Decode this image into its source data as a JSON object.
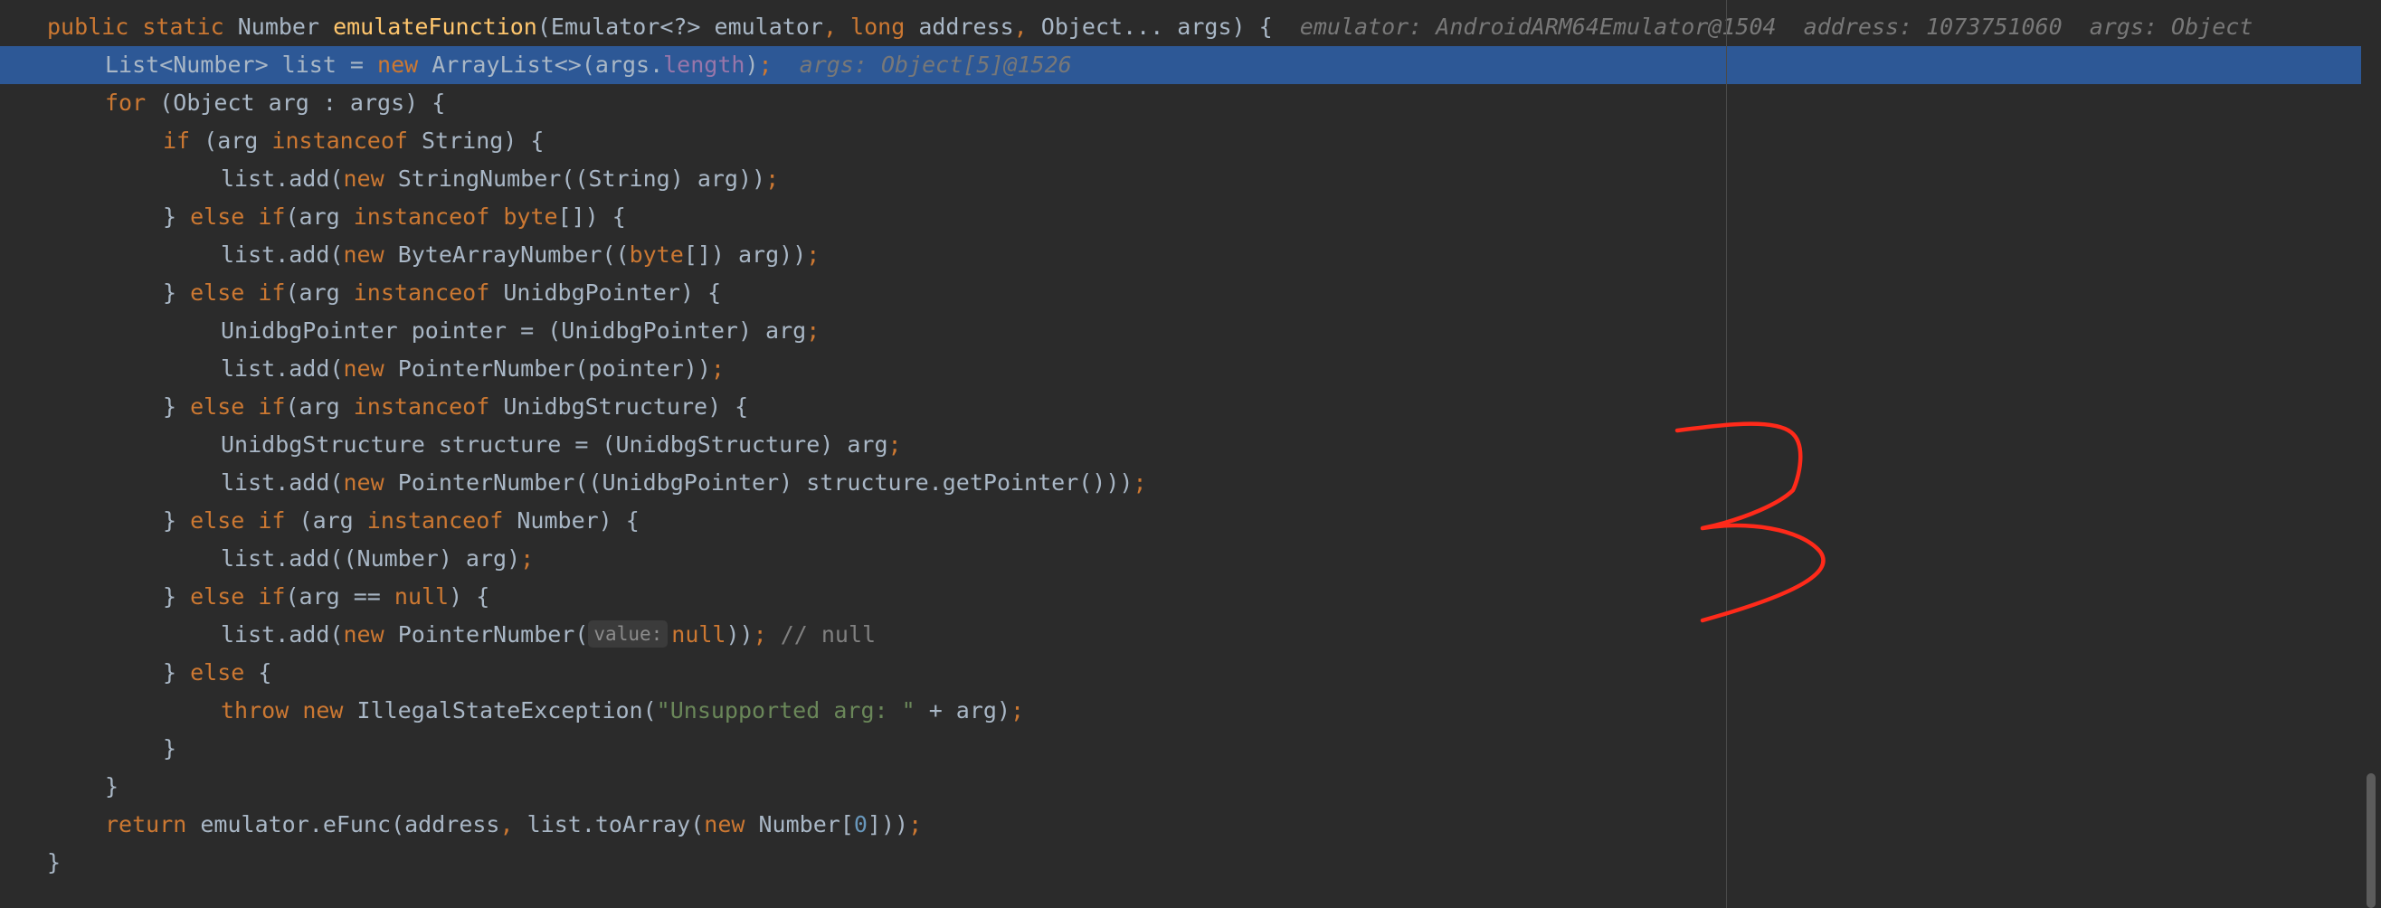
{
  "editor": {
    "lines": [
      {
        "indent": 0,
        "highlighted": false,
        "tokens": [
          {
            "t": "public ",
            "c": "kw"
          },
          {
            "t": "static ",
            "c": "kw"
          },
          {
            "t": "Number ",
            "c": ""
          },
          {
            "t": "emulateFunction",
            "c": "fn"
          },
          {
            "t": "(Emulator<?> emulator",
            "c": ""
          },
          {
            "t": ", ",
            "c": "kw"
          },
          {
            "t": "long ",
            "c": "kw"
          },
          {
            "t": "address",
            "c": ""
          },
          {
            "t": ", ",
            "c": "kw"
          },
          {
            "t": "Object... args) {  ",
            "c": ""
          },
          {
            "t": "emulator: AndroidARM64Emulator@1504  address: 1073751060  args: Object",
            "c": "hint"
          }
        ]
      },
      {
        "indent": 1,
        "highlighted": true,
        "tokens": [
          {
            "t": "List<Number> list = ",
            "c": ""
          },
          {
            "t": "new ",
            "c": "kw"
          },
          {
            "t": "ArrayList<>(args.",
            "c": ""
          },
          {
            "t": "length",
            "c": "fld"
          },
          {
            "t": ")",
            "c": ""
          },
          {
            "t": ";  ",
            "c": "kw"
          },
          {
            "t": "args: Object[5]@1526",
            "c": "hint"
          }
        ]
      },
      {
        "indent": 1,
        "highlighted": false,
        "tokens": [
          {
            "t": "for ",
            "c": "kw"
          },
          {
            "t": "(Object arg : args) {",
            "c": ""
          }
        ]
      },
      {
        "indent": 2,
        "highlighted": false,
        "tokens": [
          {
            "t": "if ",
            "c": "kw"
          },
          {
            "t": "(arg ",
            "c": ""
          },
          {
            "t": "instanceof ",
            "c": "kw"
          },
          {
            "t": "String) {",
            "c": ""
          }
        ]
      },
      {
        "indent": 3,
        "highlighted": false,
        "tokens": [
          {
            "t": "list.add(",
            "c": ""
          },
          {
            "t": "new ",
            "c": "kw"
          },
          {
            "t": "StringNumber((String) arg))",
            "c": ""
          },
          {
            "t": ";",
            "c": "kw"
          }
        ]
      },
      {
        "indent": 2,
        "highlighted": false,
        "tokens": [
          {
            "t": "} ",
            "c": ""
          },
          {
            "t": "else if",
            "c": "kw"
          },
          {
            "t": "(arg ",
            "c": ""
          },
          {
            "t": "instanceof ",
            "c": "kw"
          },
          {
            "t": "byte",
            "c": "kw"
          },
          {
            "t": "[]) {",
            "c": ""
          }
        ]
      },
      {
        "indent": 3,
        "highlighted": false,
        "tokens": [
          {
            "t": "list.add(",
            "c": ""
          },
          {
            "t": "new ",
            "c": "kw"
          },
          {
            "t": "ByteArrayNumber((",
            "c": ""
          },
          {
            "t": "byte",
            "c": "kw"
          },
          {
            "t": "[]) arg))",
            "c": ""
          },
          {
            "t": ";",
            "c": "kw"
          }
        ]
      },
      {
        "indent": 2,
        "highlighted": false,
        "tokens": [
          {
            "t": "} ",
            "c": ""
          },
          {
            "t": "else if",
            "c": "kw"
          },
          {
            "t": "(arg ",
            "c": ""
          },
          {
            "t": "instanceof ",
            "c": "kw"
          },
          {
            "t": "UnidbgPointer) {",
            "c": ""
          }
        ]
      },
      {
        "indent": 3,
        "highlighted": false,
        "tokens": [
          {
            "t": "UnidbgPointer pointer = (UnidbgPointer) arg",
            "c": ""
          },
          {
            "t": ";",
            "c": "kw"
          }
        ]
      },
      {
        "indent": 3,
        "highlighted": false,
        "tokens": [
          {
            "t": "list.add(",
            "c": ""
          },
          {
            "t": "new ",
            "c": "kw"
          },
          {
            "t": "PointerNumber(pointer))",
            "c": ""
          },
          {
            "t": ";",
            "c": "kw"
          }
        ]
      },
      {
        "indent": 2,
        "highlighted": false,
        "tokens": [
          {
            "t": "} ",
            "c": ""
          },
          {
            "t": "else if",
            "c": "kw"
          },
          {
            "t": "(arg ",
            "c": ""
          },
          {
            "t": "instanceof ",
            "c": "kw"
          },
          {
            "t": "UnidbgStructure) {",
            "c": ""
          }
        ]
      },
      {
        "indent": 3,
        "highlighted": false,
        "tokens": [
          {
            "t": "UnidbgStructure structure = (UnidbgStructure) arg",
            "c": ""
          },
          {
            "t": ";",
            "c": "kw"
          }
        ]
      },
      {
        "indent": 3,
        "highlighted": false,
        "tokens": [
          {
            "t": "list.add(",
            "c": ""
          },
          {
            "t": "new ",
            "c": "kw"
          },
          {
            "t": "PointerNumber((UnidbgPointer) structure.getPointer()))",
            "c": ""
          },
          {
            "t": ";",
            "c": "kw"
          }
        ]
      },
      {
        "indent": 2,
        "highlighted": false,
        "tokens": [
          {
            "t": "} ",
            "c": ""
          },
          {
            "t": "else if ",
            "c": "kw"
          },
          {
            "t": "(arg ",
            "c": ""
          },
          {
            "t": "instanceof ",
            "c": "kw"
          },
          {
            "t": "Number) {",
            "c": ""
          }
        ]
      },
      {
        "indent": 3,
        "highlighted": false,
        "tokens": [
          {
            "t": "list.add((Number) arg)",
            "c": ""
          },
          {
            "t": ";",
            "c": "kw"
          }
        ]
      },
      {
        "indent": 2,
        "highlighted": false,
        "tokens": [
          {
            "t": "} ",
            "c": ""
          },
          {
            "t": "else if",
            "c": "kw"
          },
          {
            "t": "(arg == ",
            "c": ""
          },
          {
            "t": "null",
            "c": "kw"
          },
          {
            "t": ") {",
            "c": ""
          }
        ]
      },
      {
        "indent": 3,
        "highlighted": false,
        "tokens": [
          {
            "t": "list.add(",
            "c": ""
          },
          {
            "t": "new ",
            "c": "kw"
          },
          {
            "t": "PointerNumber(",
            "c": ""
          },
          {
            "t": "value:",
            "c": "inlay"
          },
          {
            "t": "null",
            "c": "kw"
          },
          {
            "t": "))",
            "c": ""
          },
          {
            "t": "; ",
            "c": "kw"
          },
          {
            "t": "// null",
            "c": "cmt"
          }
        ]
      },
      {
        "indent": 2,
        "highlighted": false,
        "tokens": [
          {
            "t": "} ",
            "c": ""
          },
          {
            "t": "else ",
            "c": "kw"
          },
          {
            "t": "{",
            "c": ""
          }
        ]
      },
      {
        "indent": 3,
        "highlighted": false,
        "tokens": [
          {
            "t": "throw ",
            "c": "kw"
          },
          {
            "t": "new ",
            "c": "kw"
          },
          {
            "t": "IllegalStateException(",
            "c": ""
          },
          {
            "t": "\"Unsupported arg: \"",
            "c": "str"
          },
          {
            "t": " + arg)",
            "c": ""
          },
          {
            "t": ";",
            "c": "kw"
          }
        ]
      },
      {
        "indent": 2,
        "highlighted": false,
        "tokens": [
          {
            "t": "}",
            "c": ""
          }
        ]
      },
      {
        "indent": 1,
        "highlighted": false,
        "tokens": [
          {
            "t": "}",
            "c": ""
          }
        ]
      },
      {
        "indent": 1,
        "highlighted": false,
        "tokens": [
          {
            "t": "return ",
            "c": "kw"
          },
          {
            "t": "emulator.eFunc(address",
            "c": ""
          },
          {
            "t": ", ",
            "c": "kw"
          },
          {
            "t": "list.toArray(",
            "c": ""
          },
          {
            "t": "new ",
            "c": "kw"
          },
          {
            "t": "Number[",
            "c": ""
          },
          {
            "t": "0",
            "c": "num"
          },
          {
            "t": "]))",
            "c": ""
          },
          {
            "t": ";",
            "c": "kw"
          }
        ]
      },
      {
        "indent": 0,
        "highlighted": false,
        "tokens": [
          {
            "t": "}",
            "c": ""
          }
        ]
      }
    ]
  },
  "annotation": {
    "color": "#ff2a1a",
    "icon": "handwritten-3-annotation"
  }
}
